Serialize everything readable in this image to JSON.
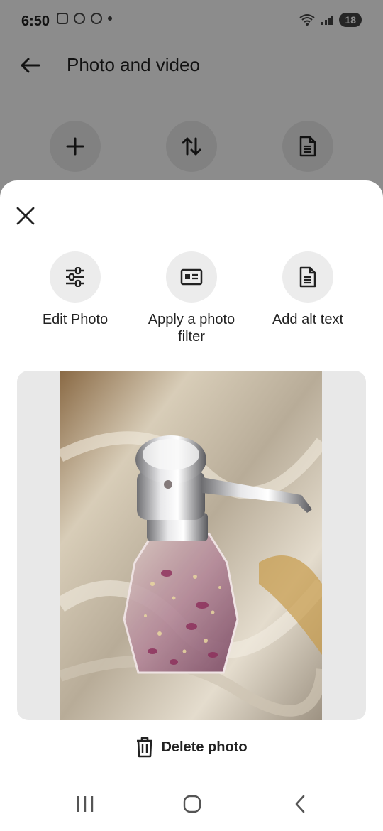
{
  "status_bar": {
    "time": "6:50",
    "battery": "18",
    "left_icons": [
      "screenshot-icon",
      "chrome-icon",
      "chrome-icon",
      "dot-icon"
    ],
    "right_icons": [
      "wifi-icon",
      "signal-icon",
      "battery-icon"
    ]
  },
  "header": {
    "title": "Photo and video",
    "back_icon": "arrow-left-icon"
  },
  "background_actions": [
    {
      "icon": "plus-icon"
    },
    {
      "icon": "sort-icon"
    },
    {
      "icon": "document-icon"
    }
  ],
  "sheet": {
    "close_icon": "close-icon",
    "actions": [
      {
        "label": "Edit Photo",
        "icon": "sliders-icon"
      },
      {
        "label": "Apply a photo filter",
        "icon": "filter-card-icon"
      },
      {
        "label": "Add alt text",
        "icon": "document-icon"
      }
    ],
    "photo_alt": "Soap dispenser on satin fabric",
    "delete_label": "Delete photo",
    "delete_icon": "trash-icon"
  },
  "nav_bar": {
    "icons": [
      "recent-apps-icon",
      "home-icon",
      "back-icon"
    ]
  },
  "colors": {
    "scrim": "#000000",
    "circle_bg": "#ececec",
    "frame_bg": "#e8e8e8",
    "text": "#222222"
  }
}
